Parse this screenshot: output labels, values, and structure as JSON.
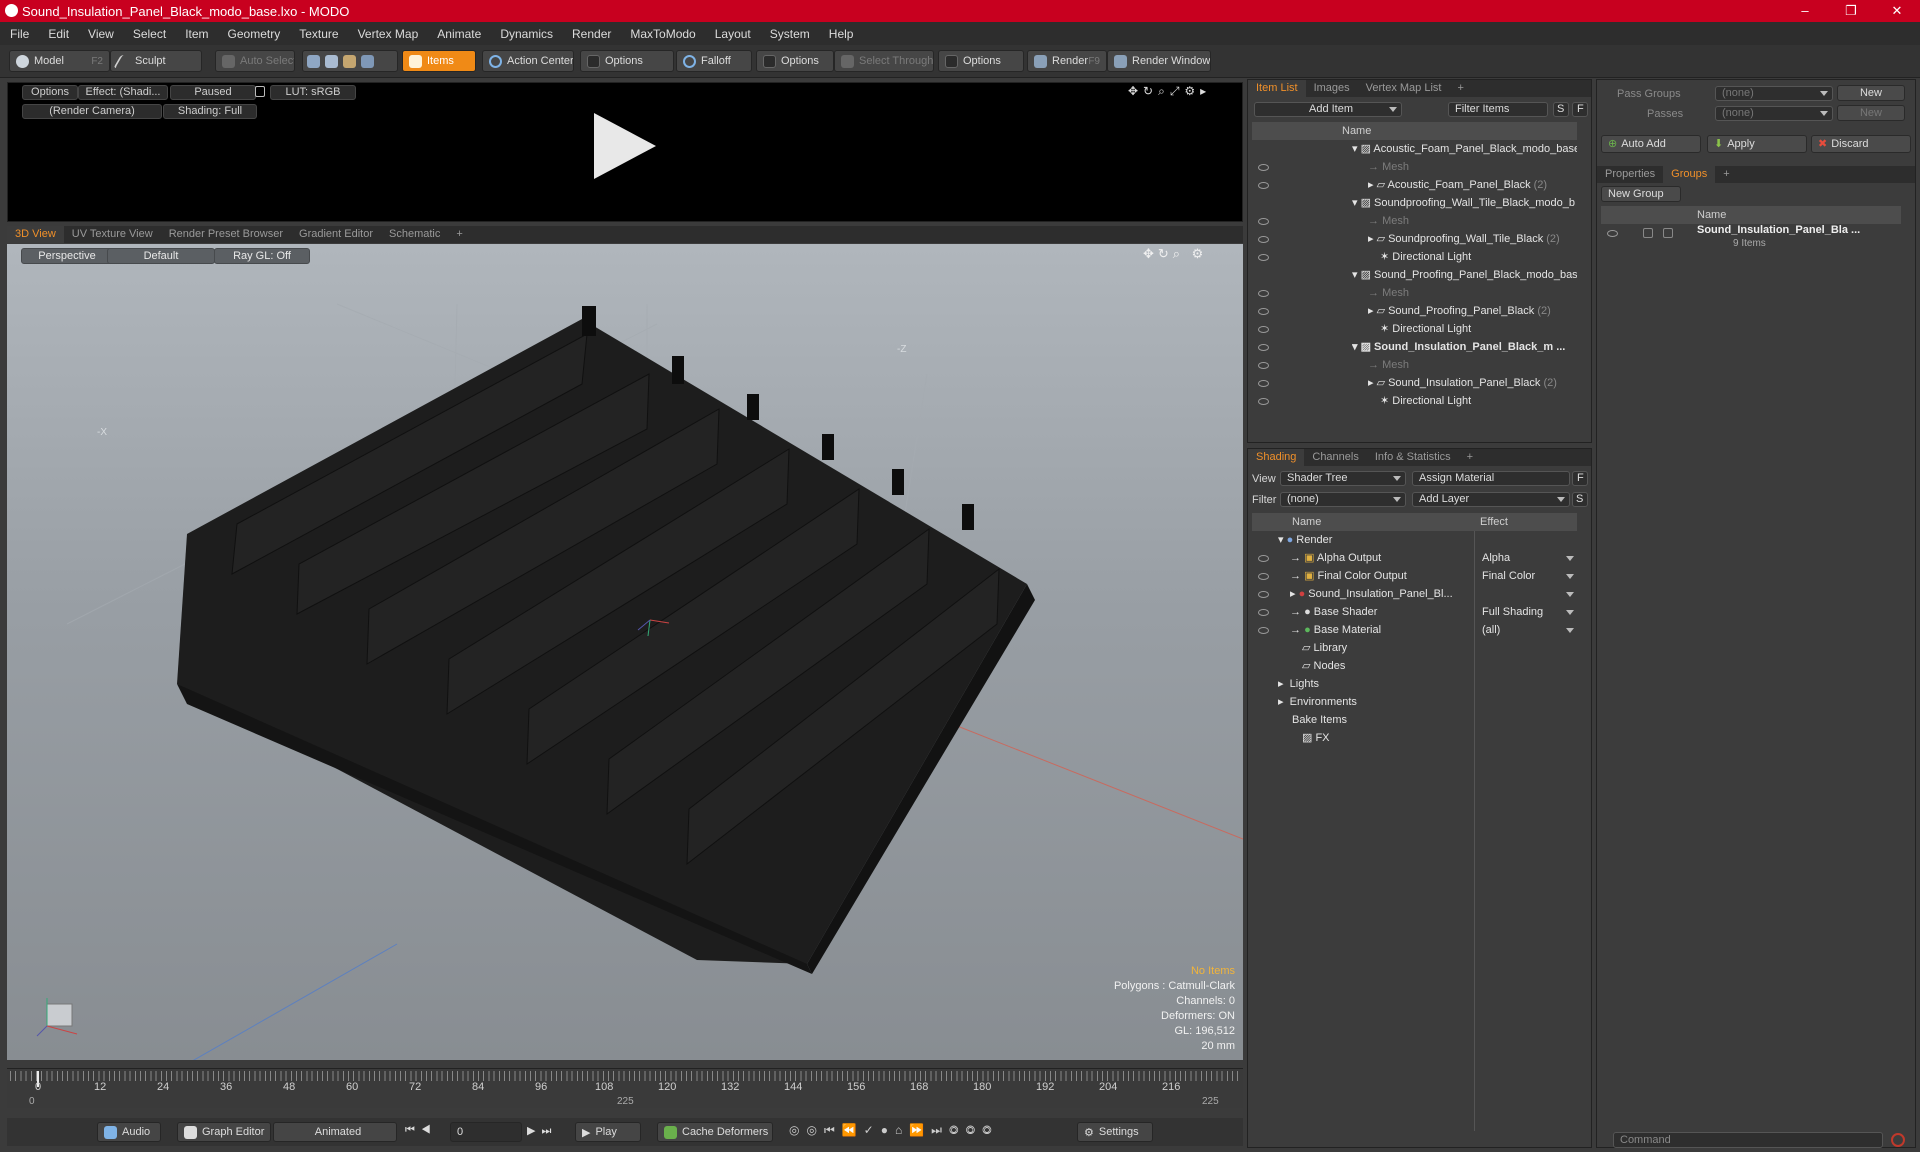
{
  "window": {
    "title": "Sound_Insulation_Panel_Black_modo_base.lxo - MODO",
    "minimize": "–",
    "restore": "❐",
    "close": "✕"
  },
  "menu": [
    "File",
    "Edit",
    "View",
    "Select",
    "Item",
    "Geometry",
    "Texture",
    "Vertex Map",
    "Animate",
    "Dynamics",
    "Render",
    "MaxToModo",
    "Layout",
    "System",
    "Help"
  ],
  "toolbar": {
    "model": "Model",
    "model_key": "F2",
    "sculpt": "Sculpt",
    "auto_select": "Auto Select",
    "items": "Items",
    "action_center": "Action Center",
    "options1": "Options",
    "falloff": "Falloff",
    "options2": "Options",
    "select_through": "Select Through",
    "options3": "Options",
    "render": "Render",
    "render_key": "F9",
    "render_window": "Render Window"
  },
  "preview": {
    "options": "Options",
    "effect": "Effect: (Shadi...",
    "paused": "Paused",
    "lut": "LUT: sRGB",
    "camera": "(Render Camera)",
    "shading": "Shading: Full"
  },
  "viewport_tabs": [
    "3D View",
    "UV Texture View",
    "Render Preset Browser",
    "Gradient Editor",
    "Schematic",
    "+"
  ],
  "viewport": {
    "projection": "Perspective",
    "style": "Default",
    "raygl": "Ray GL: Off",
    "axis_x": "-X",
    "axis_z": "-Z"
  },
  "stats": {
    "items": "No Items",
    "polygons": "Polygons : Catmull-Clark",
    "channels": "Channels: 0",
    "deformers": "Deformers: ON",
    "gl": "GL: 196,512",
    "unit": "20 mm"
  },
  "timeline": {
    "ticks": [
      "0",
      "12",
      "24",
      "36",
      "48",
      "60",
      "72",
      "84",
      "96",
      "108",
      "120",
      "132",
      "144",
      "156",
      "168",
      "180",
      "192",
      "204",
      "216"
    ],
    "start": "0",
    "mid": "225",
    "end": "225"
  },
  "bottom": {
    "audio": "Audio",
    "graph_editor": "Graph Editor",
    "animated": "Animated",
    "frame": "0",
    "play": "Play",
    "cache": "Cache Deformers",
    "settings": "Settings"
  },
  "item_list": {
    "tabs": [
      "Item List",
      "Images",
      "Vertex Map List",
      "+"
    ],
    "add_item": "Add Item",
    "filter_items": "Filter Items",
    "s": "S",
    "f": "F",
    "col_name": "Name",
    "rows": [
      {
        "label": "Acoustic_Foam_Panel_Black_modo_base...",
        "indent": 0,
        "type": "scene",
        "dim": false,
        "bold": false
      },
      {
        "label": "Mesh",
        "indent": 1,
        "type": "mesh",
        "dim": true,
        "bold": false
      },
      {
        "label": "Acoustic_Foam_Panel_Black",
        "count": "(2)",
        "indent": 1,
        "type": "group",
        "dim": false,
        "bold": false
      },
      {
        "label": "Soundproofing_Wall_Tile_Black_modo_b ...",
        "indent": 0,
        "type": "scene",
        "dim": false,
        "bold": false
      },
      {
        "label": "Mesh",
        "indent": 1,
        "type": "mesh",
        "dim": true,
        "bold": false
      },
      {
        "label": "Soundproofing_Wall_Tile_Black",
        "count": "(2)",
        "indent": 1,
        "type": "group",
        "dim": false,
        "bold": false
      },
      {
        "label": "Directional Light",
        "indent": 1,
        "type": "light",
        "dim": false,
        "bold": false
      },
      {
        "label": "Sound_Proofing_Panel_Black_modo_bas ...",
        "indent": 0,
        "type": "scene",
        "dim": false,
        "bold": false
      },
      {
        "label": "Mesh",
        "indent": 1,
        "type": "mesh",
        "dim": true,
        "bold": false
      },
      {
        "label": "Sound_Proofing_Panel_Black",
        "count": "(2)",
        "indent": 1,
        "type": "group",
        "dim": false,
        "bold": false
      },
      {
        "label": "Directional Light",
        "indent": 1,
        "type": "light",
        "dim": false,
        "bold": false
      },
      {
        "label": "Sound_Insulation_Panel_Black_m ...",
        "indent": 0,
        "type": "scene",
        "dim": false,
        "bold": true
      },
      {
        "label": "Mesh",
        "indent": 1,
        "type": "mesh",
        "dim": true,
        "bold": false
      },
      {
        "label": "Sound_Insulation_Panel_Black",
        "count": "(2)",
        "indent": 1,
        "type": "group",
        "dim": false,
        "bold": false
      },
      {
        "label": "Directional Light",
        "indent": 1,
        "type": "light",
        "dim": false,
        "bold": false
      }
    ]
  },
  "shading": {
    "tabs": [
      "Shading",
      "Channels",
      "Info & Statistics",
      "+"
    ],
    "view_label": "View",
    "view_value": "Shader Tree",
    "assign_material": "Assign Material",
    "f": "F",
    "filter_label": "Filter",
    "filter_value": "(none)",
    "add_layer": "Add Layer",
    "s": "S",
    "col_name": "Name",
    "col_effect": "Effect",
    "rows": [
      {
        "label": "Render",
        "effect": "",
        "indent": 0
      },
      {
        "label": "Alpha Output",
        "effect": "Alpha",
        "indent": 1
      },
      {
        "label": "Final Color Output",
        "effect": "Final Color",
        "indent": 1
      },
      {
        "label": "Sound_Insulation_Panel_Bl...",
        "effect": "",
        "indent": 1
      },
      {
        "label": "Base Shader",
        "effect": "Full Shading",
        "indent": 1
      },
      {
        "label": "Base Material",
        "effect": "(all)",
        "indent": 1
      },
      {
        "label": "Library",
        "effect": "",
        "indent": 1
      },
      {
        "label": "Nodes",
        "effect": "",
        "indent": 1
      },
      {
        "label": "Lights",
        "effect": "",
        "indent": 0
      },
      {
        "label": "Environments",
        "effect": "",
        "indent": 0
      },
      {
        "label": "Bake Items",
        "effect": "",
        "indent": 0
      },
      {
        "label": "FX",
        "effect": "",
        "indent": 0
      }
    ]
  },
  "groups_panel": {
    "pass_groups": "Pass Groups",
    "pass_value": "(none)",
    "new": "New",
    "passes": "Passes",
    "passes_value": "(none)",
    "new2": "New",
    "auto_add": "Auto Add",
    "apply": "Apply",
    "discard": "Discard",
    "tabs": [
      "Properties",
      "Groups",
      "+"
    ],
    "new_group": "New Group",
    "col_name": "Name",
    "group_name": "Sound_Insulation_Panel_Bla ...",
    "group_count": "9 Items",
    "command_placeholder": "Command"
  },
  "colors": {
    "accent": "#f08a16",
    "title_bar": "#c8001f"
  }
}
